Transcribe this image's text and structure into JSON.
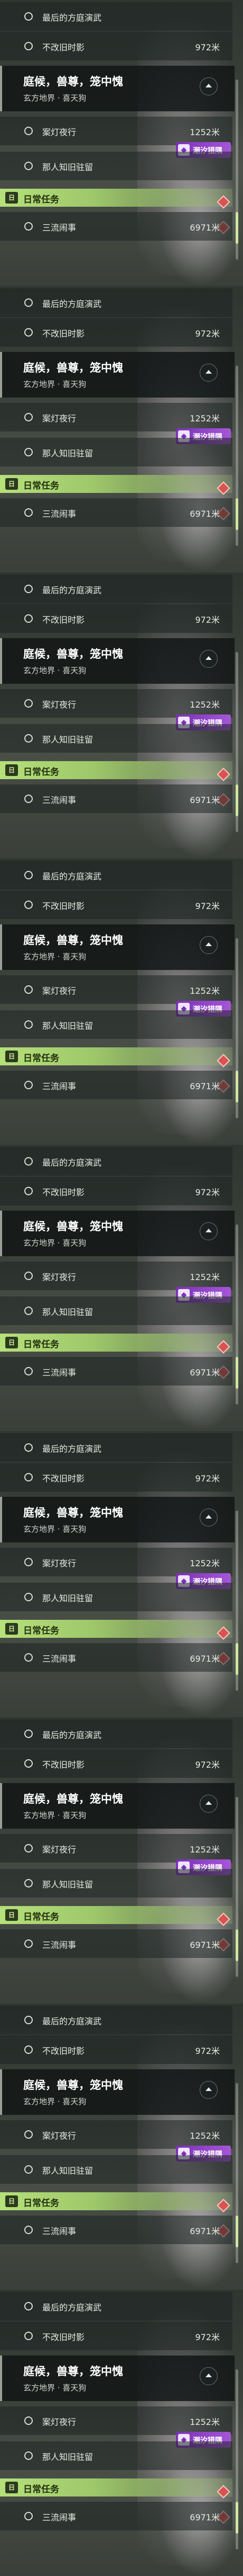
{
  "quest_list": {
    "top_rows": [
      {
        "label": "最后的方庭演武",
        "distance": ""
      },
      {
        "label": "不改旧时影",
        "distance": "972米"
      }
    ],
    "active_group": {
      "title": "庭候，兽尊，笼中愧",
      "subtitle": "玄方地界 · 喜天狗"
    },
    "sub_rows": [
      {
        "label": "案灯夜行",
        "distance": "1252米"
      },
      {
        "label": "那人知旧驻留",
        "distance": ""
      }
    ],
    "badge": {
      "label": "潮汐猎隅",
      "icon": "tide-icon"
    },
    "daily_section": {
      "icon_text": "日",
      "label": "日常任务"
    },
    "daily_rows": [
      {
        "label": "三流闹事",
        "distance": "6971米"
      }
    ]
  },
  "colors": {
    "daily_accent": "#b6e07a",
    "badge_purple": "#8a3fc4",
    "marker_red": "#d9534f"
  }
}
